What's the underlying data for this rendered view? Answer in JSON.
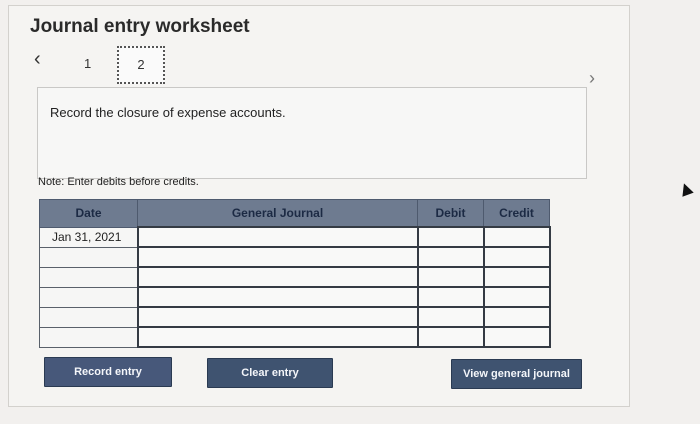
{
  "header": {
    "title": "Journal entry worksheet"
  },
  "steps": {
    "prev_icon": "‹",
    "items": [
      "1",
      "2"
    ],
    "next_icon": "›",
    "current": "2"
  },
  "instruction": "Record the closure of expense accounts.",
  "note": "Note: Enter debits before credits.",
  "table": {
    "columns": [
      "Date",
      "General Journal",
      "Debit",
      "Credit"
    ],
    "rows": [
      {
        "date": "Jan 31, 2021",
        "account": "",
        "debit": "",
        "credit": ""
      },
      {
        "date": "",
        "account": "",
        "debit": "",
        "credit": ""
      },
      {
        "date": "",
        "account": "",
        "debit": "",
        "credit": ""
      },
      {
        "date": "",
        "account": "",
        "debit": "",
        "credit": ""
      },
      {
        "date": "",
        "account": "",
        "debit": "",
        "credit": ""
      },
      {
        "date": "",
        "account": "",
        "debit": "",
        "credit": ""
      }
    ]
  },
  "buttons": {
    "record": "Record entry",
    "clear": "Clear entry",
    "view": "View general journal"
  },
  "colors": {
    "header_bg": "#6e7b90",
    "button_bg": "#3f5370"
  }
}
